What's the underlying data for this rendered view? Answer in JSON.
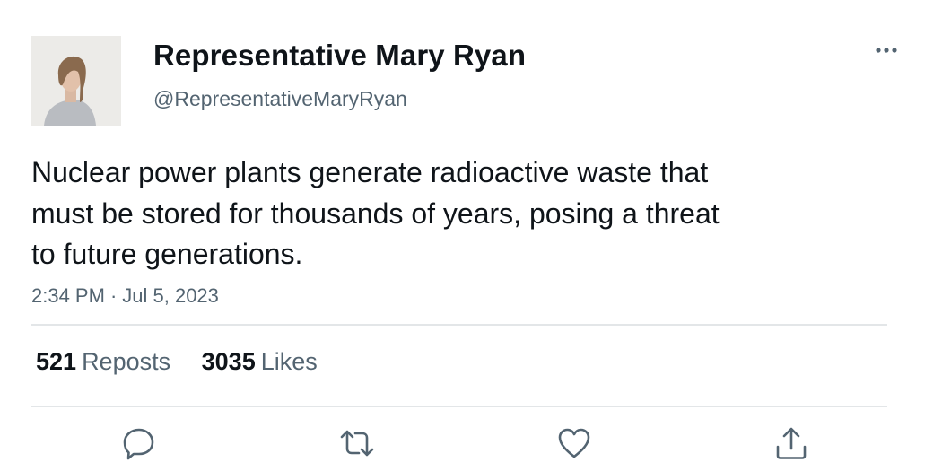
{
  "author": {
    "display_name": "Representative Mary Ryan",
    "handle": "@RepresentativeMaryRyan"
  },
  "tweet": {
    "text_lines": [
      "Nuclear power plants generate radioactive waste that",
      "must be stored for thousands of years, posing a threat",
      "to future generations."
    ],
    "time": "2:34 PM",
    "separator": "·",
    "date": "Jul 5, 2023"
  },
  "stats": {
    "reposts_count": "521",
    "reposts_label": "Reposts",
    "likes_count": "3035",
    "likes_label": "Likes"
  },
  "icons": {
    "more": "more-horizontal-icon",
    "reply": "reply-icon",
    "repost": "repost-icon",
    "like": "heart-icon",
    "share": "share-icon"
  },
  "colors": {
    "text_primary": "#0f1419",
    "text_secondary": "#536471",
    "divider": "#e3e6e8"
  }
}
